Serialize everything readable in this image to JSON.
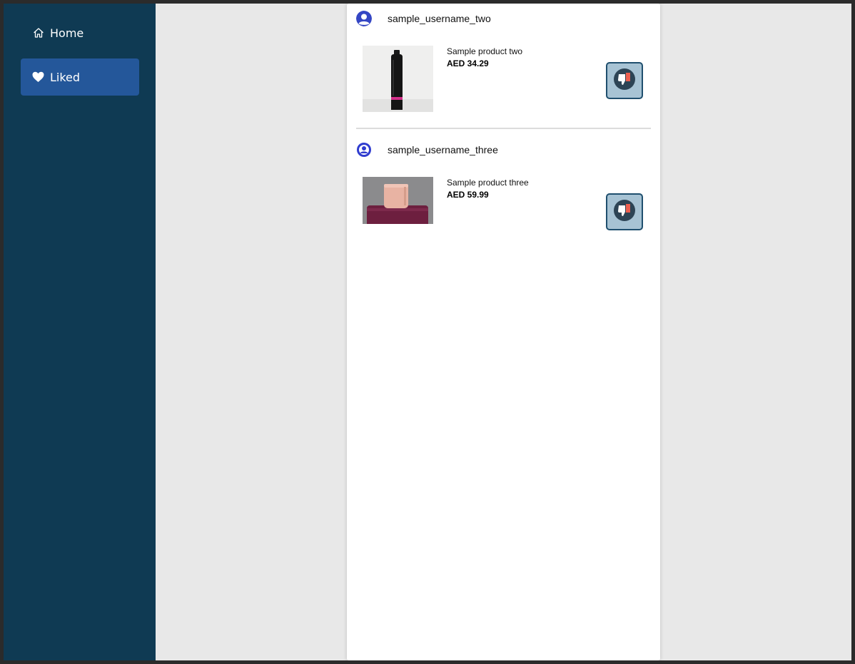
{
  "sidebar": {
    "items": [
      {
        "label": "Home",
        "icon": "home-icon",
        "active": false
      },
      {
        "label": "Liked",
        "icon": "heart-icon",
        "active": true
      }
    ]
  },
  "colors": {
    "sidebar_bg": "#0f3a53",
    "active_nav_bg": "#24579a",
    "dislike_button_bg": "#a7c3d4",
    "avatar_blue": "#3446c4"
  },
  "posts": [
    {
      "username": "sample_username_two",
      "product_name": "Sample product two",
      "price": "AED 34.29",
      "image": "black-bottle",
      "action_icon": "thumbs-down-icon"
    },
    {
      "username": "sample_username_three",
      "product_name": "Sample product three",
      "price": "AED 59.99",
      "image": "pink-bag-on-suitcase",
      "action_icon": "thumbs-down-icon"
    }
  ]
}
